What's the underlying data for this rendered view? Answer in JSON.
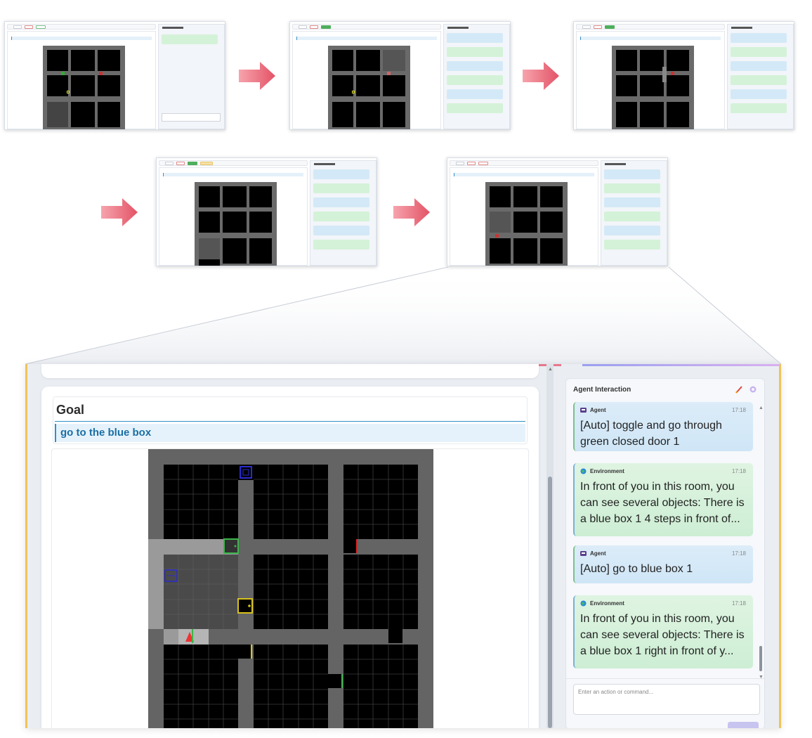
{
  "goal": {
    "title": "Goal",
    "text": "go to the blue box"
  },
  "panel": {
    "title": "Agent Interaction",
    "input_placeholder": "Enter an action or command...",
    "send_label": ""
  },
  "messages": [
    {
      "sender": "Agent",
      "time": "17:18",
      "text": "[Auto] toggle and go through green closed door 1"
    },
    {
      "sender": "Environment",
      "time": "17:18",
      "text": "In front of you in this room, you can see several objects: There is a blue box 1 4 steps in front of..."
    },
    {
      "sender": "Agent",
      "time": "17:18",
      "text": "[Auto] go to blue box 1"
    },
    {
      "sender": "Environment",
      "time": "17:18",
      "text": "In front of you in this room, you can see several objects: There is a blue box 1 right in front of y..."
    }
  ],
  "colors": {
    "agent_bubble": "#d4e9f7",
    "environment_bubble": "#d4f2d8",
    "goal_accent": "#2f8fc9",
    "frame_accent": "#f0c35a"
  },
  "icons": [
    "agent-icon",
    "environment-icon",
    "pen-icon",
    "gear-icon",
    "arrow-right-icon"
  ]
}
